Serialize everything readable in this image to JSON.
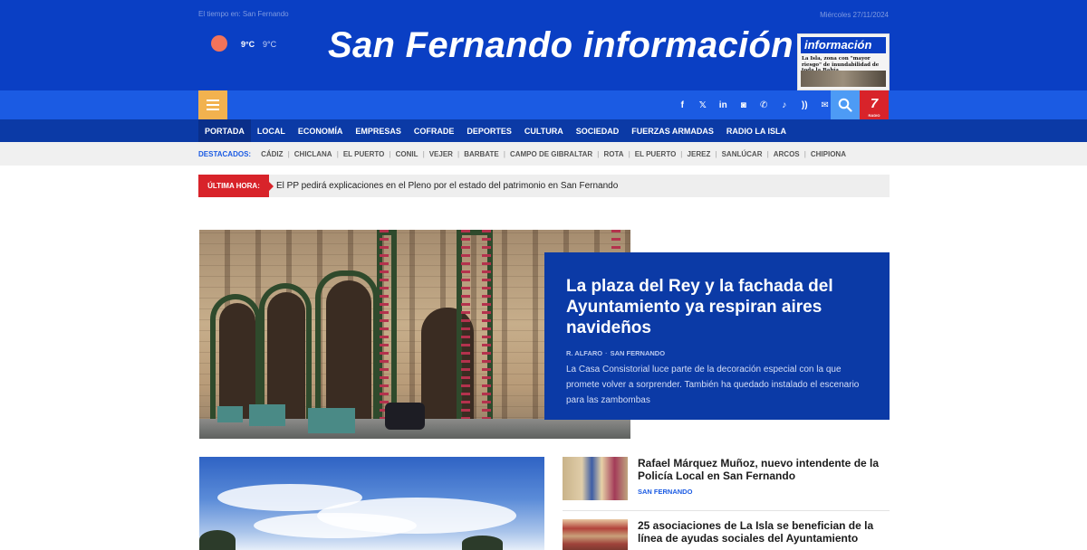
{
  "header": {
    "weather_label": "El tiempo en: San Fernando",
    "temp_max": "9°C",
    "temp_min": "9°C",
    "date": "Miércoles 27/11/2024",
    "site_title": "San Fernando información",
    "paper": {
      "masthead": "información",
      "headline": "La Isla, zona con \"mayor riesgo\" de inundabilidad de toda la Bahía"
    }
  },
  "toolbar": {
    "socials": [
      {
        "name": "facebook",
        "glyph": "f"
      },
      {
        "name": "x",
        "glyph": "𝕏"
      },
      {
        "name": "linkedin",
        "glyph": "in"
      },
      {
        "name": "instagram",
        "glyph": "◙"
      },
      {
        "name": "whatsapp",
        "glyph": "✆"
      },
      {
        "name": "tiktok",
        "glyph": "♪"
      },
      {
        "name": "rss",
        "glyph": "))"
      },
      {
        "name": "email",
        "glyph": "✉"
      }
    ],
    "radio_logo": "7",
    "radio_sub": "RADIO"
  },
  "nav": {
    "items": [
      "PORTADA",
      "LOCAL",
      "ECONOMÍA",
      "EMPRESAS",
      "COFRADE",
      "DEPORTES",
      "CULTURA",
      "SOCIEDAD",
      "FUERZAS ARMADAS",
      "RADIO LA ISLA"
    ]
  },
  "destacados": {
    "title": "DESTACADOS:",
    "links": [
      "CÁDIZ",
      "CHICLANA",
      "EL PUERTO",
      "CONIL",
      "VEJER",
      "BARBATE",
      "CAMPO DE GIBRALTAR",
      "ROTA",
      "EL PUERTO",
      "JEREZ",
      "SANLÚCAR",
      "ARCOS",
      "CHIPIONA"
    ]
  },
  "breaking": {
    "tag": "ÚLTIMA HORA:",
    "text": "El PP pedirá explicaciones en el Pleno por el estado del patrimonio en San Fernando"
  },
  "hero": {
    "title": "La plaza del Rey y la fachada del Ayuntamiento ya respiran aires navideños",
    "author": "R. ALFARO",
    "section": "SAN FERNANDO",
    "description": "La Casa Consistorial luce parte de la decoración especial con la que promete volver a sorprender. También ha quedado instalado el escenario para las zambombas"
  },
  "news": [
    {
      "title": "Rafael Márquez Muñoz, nuevo intendente de la Policía Local en San Fernando",
      "tag": "SAN FERNANDO"
    },
    {
      "title": "25 asociaciones de La Isla se benefician de la línea de ayudas sociales del Ayuntamiento",
      "tag": ""
    }
  ],
  "colors": {
    "brand_blue": "#0a3fc4",
    "toolbar_blue": "#1b5be3",
    "nav_blue": "#0b3aa6",
    "accent_red": "#d8232a",
    "menu_orange": "#f2b24f"
  }
}
